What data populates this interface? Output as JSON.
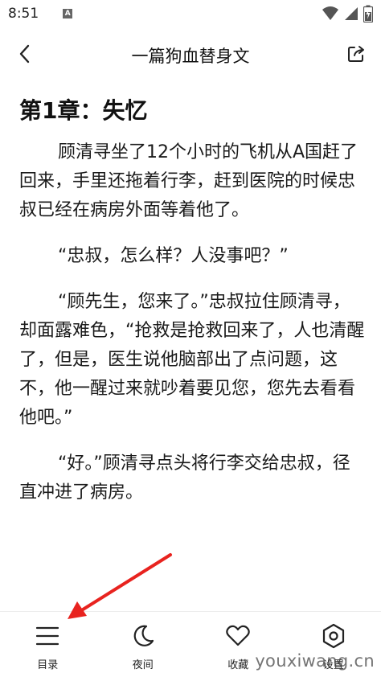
{
  "status_bar": {
    "time": "8:51",
    "app_badge": "A",
    "icons": [
      "wifi-icon",
      "signal-icon",
      "battery-icon"
    ]
  },
  "header": {
    "title": "一篇狗血替身文",
    "back_icon": "chevron-left-icon",
    "share_icon": "share-icon"
  },
  "chapter": {
    "title": "第1章：失忆",
    "paragraphs": [
      "顾清寻坐了12个小时的飞机从A国赶了回来，手里还拖着行李，赶到医院的时候忠叔已经在病房外面等着他了。",
      "“忠叔，怎么样？人没事吧？”",
      "“顾先生，您来了。”忠叔拉住顾清寻，却面露难色，“抢救是抢救回来了，人也清醒了，但是，医生说他脑部出了点问题，这不，他一醒过来就吵着要见您，您先去看看他吧。”",
      "“好。”顾清寻点头将行李交给忠叔，径直冲进了病房。"
    ]
  },
  "bottom_nav": {
    "items": [
      {
        "label": "目录",
        "icon": "menu-list-icon"
      },
      {
        "label": "夜间",
        "icon": "moon-icon"
      },
      {
        "label": "收藏",
        "icon": "heart-icon"
      },
      {
        "label": "设置",
        "icon": "settings-icon"
      }
    ]
  },
  "annotation": {
    "color": "#e8231f"
  },
  "watermark": "youxiwang.cn"
}
